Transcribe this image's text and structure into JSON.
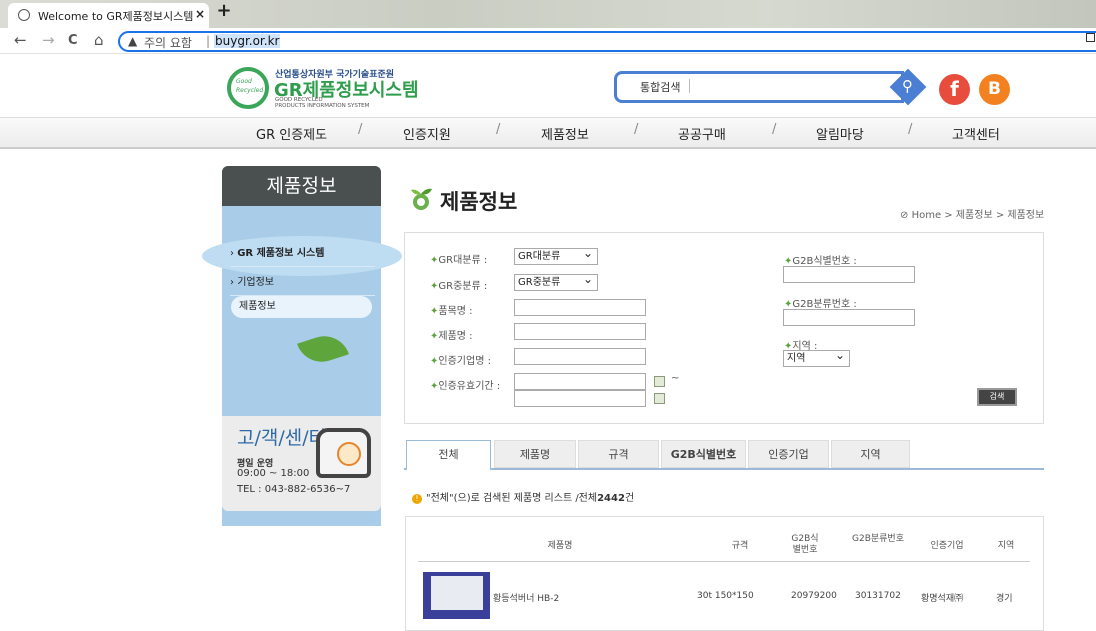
{
  "browser": {
    "tab_title": "Welcome to GR제품정보시스템",
    "tab_close": "×",
    "new_tab": "+",
    "back": "←",
    "forward": "→",
    "reload": "C",
    "home": "⌂",
    "security_icon": "warning-triangle-icon",
    "security_text": "주의 요함",
    "url": "buygr.or.kr"
  },
  "header": {
    "logo_line1": "산업통상자원부 국가기술표준원",
    "logo_title": "GR제품정보시스템",
    "logo_sub1": "GOOD RECYCLED",
    "logo_sub2": "PRODUCTS INFORMATION SYSTEM",
    "logo_mark_1": "Good",
    "logo_mark_2": "Recycled",
    "search_label": "통합검색",
    "facebook": "f",
    "blogger": "B"
  },
  "gnb": {
    "items": [
      "GR 인증제도",
      "인증지원",
      "제품정보",
      "공공구매",
      "알림마당",
      "고객센터"
    ],
    "separator": "/"
  },
  "sidebar": {
    "title": "제품정보",
    "menu": [
      "GR 제품정보 시스템",
      "기업정보",
      "제품정보"
    ],
    "cs_title": "고/객/센/터",
    "cs_hours_label": "평일 운영",
    "cs_hours": "09:00 ~ 18:00",
    "cs_tel": "TEL : 043-882-6536~7"
  },
  "main": {
    "title": "제품정보",
    "breadcrumb": "Home > 제품정보 > 제품정보",
    "form": {
      "gr_major_label": "GR대분류 :",
      "gr_major_value": "GR대분류",
      "gr_mid_label": "GR중분류 :",
      "gr_mid_value": "GR중분류",
      "item_label": "품목명 :",
      "product_label": "제품명 :",
      "company_label": "인증기업명 :",
      "period_label": "인증유효기간 :",
      "tilde": "~",
      "g2b_id_label": "G2B식별번호 :",
      "g2b_class_label": "G2B분류번호 :",
      "region_label": "지역 :",
      "region_value": "지역",
      "search_button": "검색",
      "bullet": "✦"
    },
    "tabs": [
      "전체",
      "제품명",
      "규격",
      "G2B식별번호",
      "인증기업",
      "지역"
    ],
    "count_prefix": "\"전체\"(으)로 검색된 제품명 리스트 /전체",
    "count_value": "2442",
    "count_suffix": "건",
    "table": {
      "headers": [
        "제품명",
        "규격",
        "G2B식별번호",
        "G2B분류번호",
        "인증기업",
        "지역"
      ],
      "rows": [
        {
          "name": "황등석버너 HB-2",
          "spec": "30t 150*150",
          "g2b_id": "20979200",
          "g2b_class": "30131702",
          "company": "황명석재㈜",
          "region": "경기"
        }
      ]
    }
  }
}
